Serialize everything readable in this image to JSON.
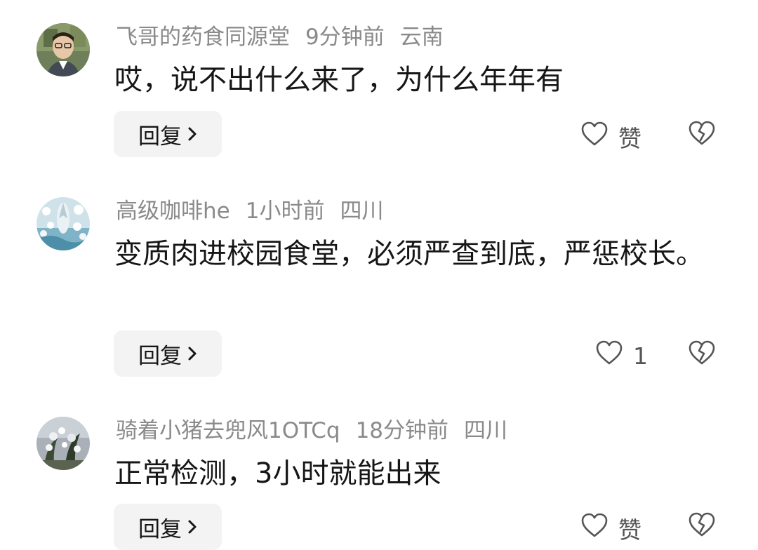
{
  "comments": [
    {
      "username": "飞哥的药食同源堂",
      "time": "9分钟前",
      "location": "云南",
      "text": "哎，说不出什么来了，为什么年年有",
      "reply_label": "回复",
      "like_label": "赞"
    },
    {
      "username": "高级咖啡he",
      "time": "1小时前",
      "location": "四川",
      "text": "变质肉进校园食堂，必须严查到底，严惩校长。",
      "reply_label": "回复",
      "like_label": "1"
    },
    {
      "username": "骑着小猪去兜风1OTCq",
      "time": "18分钟前",
      "location": "四川",
      "text": "正常检测，3小时就能出来",
      "reply_label": "回复",
      "like_label": "赞"
    }
  ],
  "icons": {
    "like": "heart-outline-icon",
    "dislike": "broken-heart-icon",
    "reply_chevron": "chevron-right-icon"
  },
  "colors": {
    "meta_text": "#8a8a8a",
    "body_text": "#161616",
    "reply_button_bg": "#f3f3f3"
  }
}
